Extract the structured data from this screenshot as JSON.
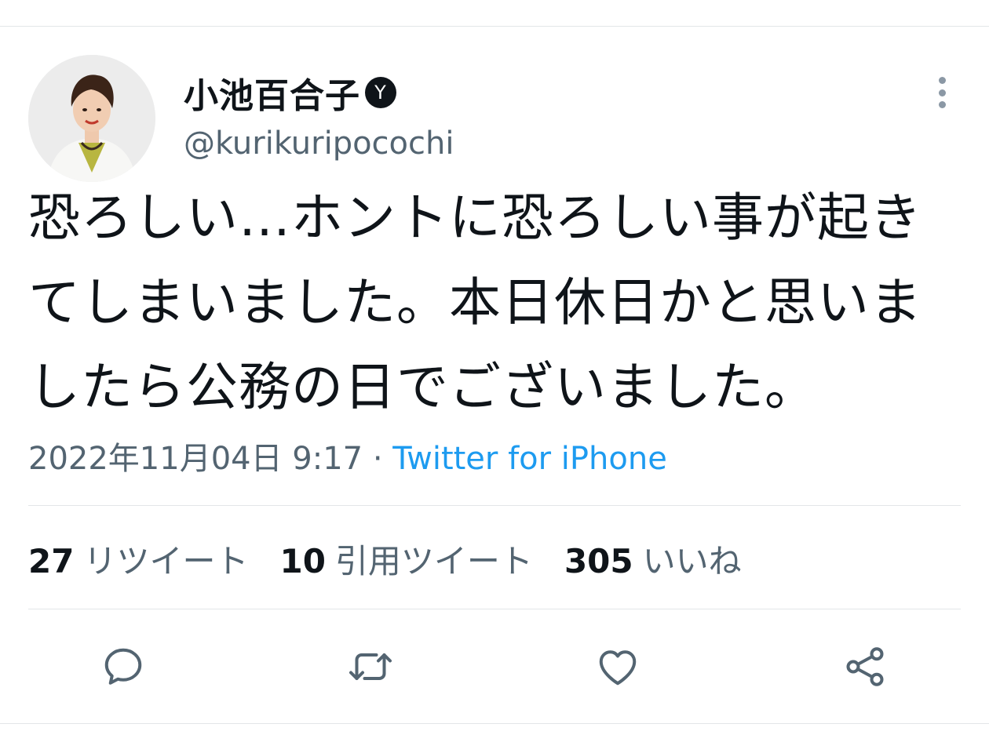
{
  "tweet": {
    "author": {
      "display_name": "小池百合子",
      "badge_glyph": "Y",
      "handle": "@kurikuripocochi"
    },
    "text": "恐ろしい…ホントに恐ろしい事が起きてしまいました。本日休日かと思いましたら公務の日でございました。",
    "timestamp": "2022年11月04日 9:17",
    "separator": "·",
    "source": "Twitter for iPhone",
    "stats": {
      "retweets_count": "27",
      "retweets_label": "リツイート",
      "quotes_count": "10",
      "quotes_label": "引用ツイート",
      "likes_count": "305",
      "likes_label": "いいね"
    }
  },
  "actions": {
    "icons": [
      "reply-icon",
      "retweet-icon",
      "like-icon",
      "share-icon"
    ]
  },
  "colors": {
    "text_primary": "#0f1419",
    "text_secondary": "#536471",
    "link": "#1d9bf0",
    "icon": "#536471",
    "divider": "#e3e6e8"
  }
}
